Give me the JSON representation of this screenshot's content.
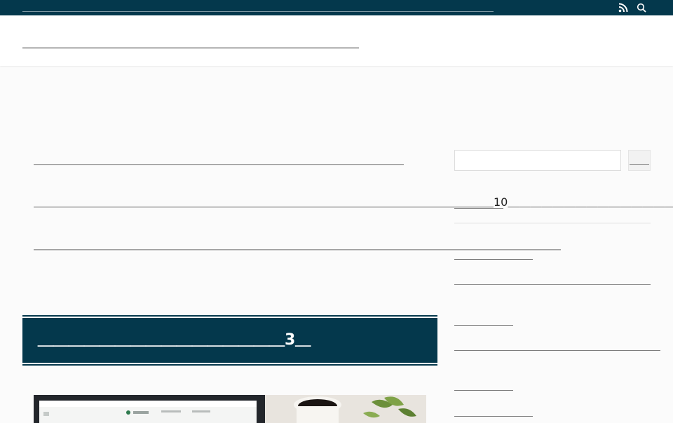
{
  "topbar": {
    "tagline": "＿＿＿＿＿＿＿＿＿＿＿＿＿＿＿＿＿＿＿＿＿＿＿＿＿＿＿＿＿＿＿＿＿＿＿＿＿＿＿＿＿＿＿＿＿＿＿＿＿＿＿＿＿＿＿＿",
    "icons": [
      "rss-icon",
      "search-icon"
    ]
  },
  "header": {
    "site_title": "＿＿＿＿＿＿＿＿＿＿＿＿＿＿＿＿＿＿＿＿"
  },
  "main": {
    "paragraphs": [
      "＿＿＿＿＿＿＿＿＿＿＿＿＿＿＿＿＿＿＿＿＿＿＿＿＿＿＿＿＿＿＿＿＿",
      "＿＿＿＿＿＿＿＿＿＿＿＿＿＿＿＿＿＿＿＿＿＿＿＿＿＿＿＿＿＿＿＿＿＿＿＿＿＿＿＿＿10＿＿＿＿＿＿＿＿＿＿＿＿＿＿＿＿＿",
      "＿＿＿＿＿＿＿＿＿＿＿＿＿＿＿＿＿＿＿＿＿＿＿＿＿＿＿＿＿＿＿＿＿＿＿＿＿＿＿＿＿＿＿＿＿＿＿"
    ],
    "heading": "＿＿＿＿＿＿＿＿＿＿＿＿＿＿＿＿3＿"
  },
  "sidebar": {
    "search_button": "＿＿",
    "heading": "＿＿＿＿＿",
    "items": [
      "＿＿＿＿＿＿＿＿",
      "＿＿＿＿＿＿＿＿＿＿＿＿＿＿＿＿＿＿＿＿",
      "＿＿＿＿＿＿",
      "＿＿＿＿＿＿＿＿＿＿＿＿＿＿＿＿＿＿＿＿＿",
      "＿＿＿＿＿＿",
      "＿＿＿＿＿＿＿＿"
    ]
  },
  "colors": {
    "brand_dark": "#04384c",
    "background": "#fbfbfb"
  }
}
